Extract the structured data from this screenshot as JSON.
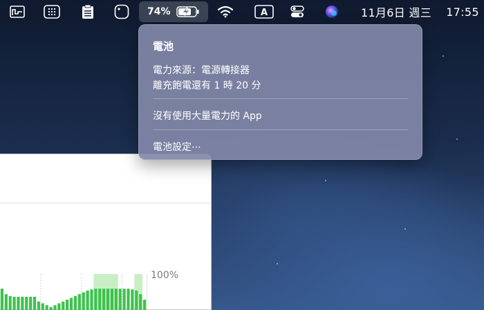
{
  "menubar": {
    "battery_percent": "74%",
    "date": "11月6日 週三",
    "time": "17:55"
  },
  "battery_menu": {
    "title": "電池",
    "power_source": "電力來源：電源轉接器",
    "time_to_full": "離充飽電還有 1 時 20 分",
    "apps_status": "沒有使用大量電力的 App",
    "settings": "電池設定⋯"
  },
  "chart_data": {
    "type": "bar",
    "values": [
      60,
      45,
      40,
      38,
      38,
      38,
      38,
      38,
      38,
      25,
      20,
      15,
      10,
      15,
      20,
      25,
      30,
      35,
      40,
      45,
      50,
      55,
      58,
      60,
      60,
      60,
      60,
      60,
      60,
      60,
      60,
      60,
      58,
      55,
      45,
      30
    ],
    "charging_bands": [
      [
        23,
        29
      ],
      [
        33,
        35
      ]
    ],
    "ylim": [
      0,
      100
    ],
    "y_tick_label": "100%",
    "colors": {
      "bar": "#3ec24f",
      "charging_band": "#c8efc4",
      "grid": "#cfcfcf"
    }
  }
}
